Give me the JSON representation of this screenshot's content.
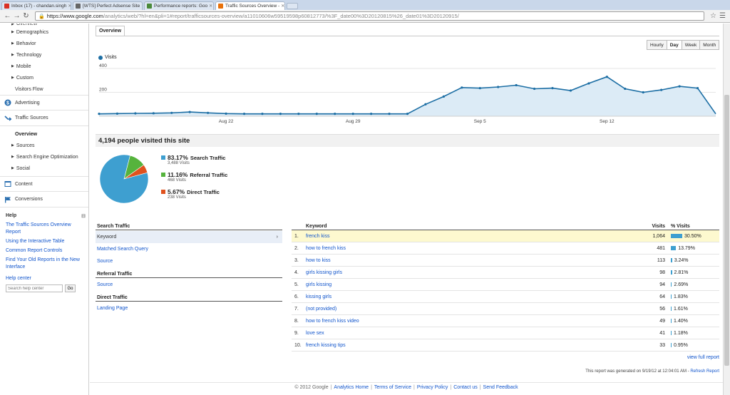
{
  "browser": {
    "tabs": [
      {
        "label": "Inbox (17) - chandan.singh",
        "color": "#d93025",
        "active": false
      },
      {
        "label": "[WTS] Perfect Adsense Site",
        "color": "#666666",
        "active": false
      },
      {
        "label": "Performance reports: Goo",
        "color": "#4a8a3a",
        "active": false
      },
      {
        "label": "Traffic Sources Overview -",
        "color": "#e8710a",
        "active": true
      }
    ],
    "url_host": "https://www.google.com",
    "url_path": "/analytics/web/?hl=en&pli=1#report/trafficsources-overview/a11010606w59519598p60812773/%3F_date00%3D20120815%26_date01%3D20120915/"
  },
  "sidebar": {
    "top_items": [
      "Overview",
      "Demographics",
      "Behavior",
      "Technology",
      "Mobile",
      "Custom",
      "Visitors Flow"
    ],
    "advertising": "Advertising",
    "traffic_sources": "Traffic Sources",
    "traffic_items": [
      "Overview",
      "Sources",
      "Search Engine Optimization",
      "Social"
    ],
    "content": "Content",
    "conversions": "Conversions",
    "help": {
      "title": "Help",
      "links": [
        "The Traffic Sources Overview Report",
        "Using the Interactive Table",
        "Common Report Controls",
        "Find Your Old Reports in the New Interface"
      ],
      "help_center": "Help center",
      "search_placeholder": "Search help center",
      "go": "Go"
    }
  },
  "main": {
    "tab": "Overview",
    "granularity": [
      "Hourly",
      "Day",
      "Week",
      "Month"
    ],
    "granularity_active": "Day",
    "legend": "Visits",
    "summary": "4,194 people visited this site",
    "pie": [
      {
        "pct": "83.17%",
        "name": "Search Traffic",
        "visits": "3,488 Visits",
        "color": "#3e9fd0",
        "value": 83.17
      },
      {
        "pct": "11.16%",
        "name": "Referral Traffic",
        "visits": "468 Visits",
        "color": "#56b33d",
        "value": 11.16
      },
      {
        "pct": "5.67%",
        "name": "Direct Traffic",
        "visits": "238 Visits",
        "color": "#e0521e",
        "value": 5.67
      }
    ],
    "nav": {
      "search_head": "Search Traffic",
      "search_items": [
        "Keyword",
        "Matched Search Query",
        "Source"
      ],
      "referral_head": "Referral Traffic",
      "referral_items": [
        "Source"
      ],
      "direct_head": "Direct Traffic",
      "direct_items": [
        "Landing Page"
      ]
    },
    "table": {
      "headers": {
        "keyword": "Keyword",
        "visits": "Visits",
        "pct": "% Visits"
      },
      "rows": [
        {
          "n": "1.",
          "kw": "french kiss",
          "visits": "1,064",
          "pct": "30.50%",
          "v": 30.5
        },
        {
          "n": "2.",
          "kw": "how to french kiss",
          "visits": "481",
          "pct": "13.79%",
          "v": 13.79
        },
        {
          "n": "3.",
          "kw": "how to kiss",
          "visits": "113",
          "pct": "3.24%",
          "v": 3.24
        },
        {
          "n": "4.",
          "kw": "girls kissing girls",
          "visits": "98",
          "pct": "2.81%",
          "v": 2.81
        },
        {
          "n": "5.",
          "kw": "girls kissing",
          "visits": "94",
          "pct": "2.69%",
          "v": 2.69
        },
        {
          "n": "6.",
          "kw": "kissing girls",
          "visits": "64",
          "pct": "1.83%",
          "v": 1.83
        },
        {
          "n": "7.",
          "kw": "(not provided)",
          "visits": "56",
          "pct": "1.61%",
          "v": 1.61
        },
        {
          "n": "8.",
          "kw": "how to french kiss video",
          "visits": "49",
          "pct": "1.40%",
          "v": 1.4
        },
        {
          "n": "9.",
          "kw": "love sex",
          "visits": "41",
          "pct": "1.18%",
          "v": 1.18
        },
        {
          "n": "10.",
          "kw": "french kissing tips",
          "visits": "33",
          "pct": "0.95%",
          "v": 0.95
        }
      ]
    },
    "view_full": "view full report",
    "generated": "This report was generated on 9/19/12 at 12:04:01 AM - ",
    "refresh": "Refresh Report"
  },
  "footer": {
    "copyright": "© 2012 Google",
    "links": [
      "Analytics Home",
      "Terms of Service",
      "Privacy Policy",
      "Contact us",
      "Send Feedback"
    ]
  },
  "chart_data": {
    "type": "area",
    "series": [
      {
        "name": "Visits",
        "values": [
          20,
          22,
          24,
          25,
          28,
          35,
          28,
          22,
          20,
          20,
          20,
          20,
          20,
          20,
          20,
          20,
          20,
          20,
          100,
          165,
          240,
          235,
          245,
          260,
          230,
          235,
          215,
          275,
          330,
          230,
          200,
          220,
          250,
          235,
          20
        ]
      }
    ],
    "x": [
      "Aug 15",
      "Aug 16",
      "Aug 17",
      "Aug 18",
      "Aug 19",
      "Aug 20",
      "Aug 21",
      "Aug 22",
      "Aug 23",
      "Aug 24",
      "Aug 25",
      "Aug 26",
      "Aug 27",
      "Aug 28",
      "Aug 29",
      "Aug 30",
      "Aug 31",
      "Sep 1",
      "Sep 2",
      "Sep 3",
      "Sep 4",
      "Sep 5",
      "Sep 6",
      "Sep 7",
      "Sep 8",
      "Sep 9",
      "Sep 10",
      "Sep 11",
      "Sep 12",
      "Sep 13",
      "Sep 14",
      "Sep 15",
      "Sep 16",
      "Sep 17",
      "Sep 18"
    ],
    "x_tick_labels": [
      "Aug 22",
      "Aug 29",
      "Sep 5",
      "Sep 12"
    ],
    "y_tick_labels": [
      "400",
      "200"
    ],
    "ylim": [
      0,
      400
    ],
    "color": "#1c6ea4",
    "fill": "#dcebf6"
  }
}
